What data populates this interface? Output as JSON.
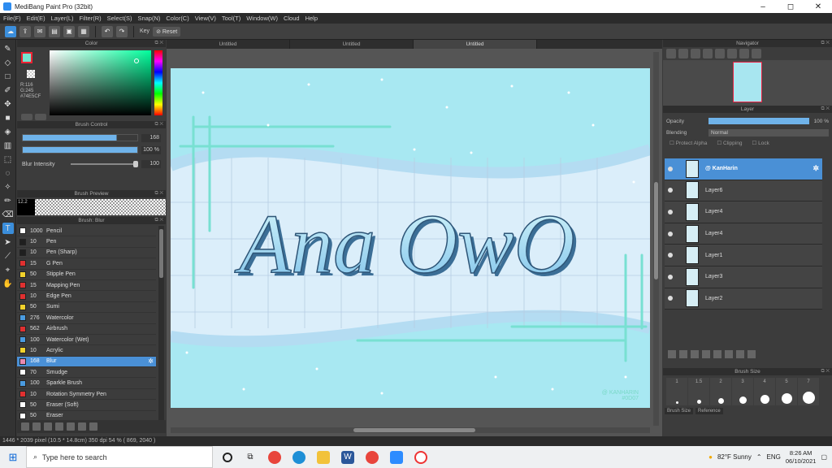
{
  "app": {
    "title": "MediBang Paint Pro (32bit)",
    "window_controls": [
      "–",
      "◻",
      "✕"
    ]
  },
  "menu": [
    "File(F)",
    "Edit(E)",
    "Layer(L)",
    "Filter(R)",
    "Select(S)",
    "Snap(N)",
    "Color(C)",
    "View(V)",
    "Tool(T)",
    "Window(W)",
    "Cloud",
    "Help"
  ],
  "toolbar": {
    "key_label": "Key",
    "reset_label": "Reset"
  },
  "color_panel": {
    "title": "Color",
    "rgb_text": [
      "R:116",
      "G:245",
      "#74E5CF"
    ],
    "accent_hex": "#74E5CF"
  },
  "brush_control": {
    "title": "Brush Control",
    "size_value": "168",
    "opacity_value": "100 %",
    "blur_label": "Blur Intensity",
    "blur_value": "100",
    "size_level": 0.82,
    "opacity_level": 1.0
  },
  "brush_preview": {
    "title": "Brush Preview",
    "size_label": "12.2"
  },
  "brush_list": {
    "title": "Brush: Blur",
    "items": [
      {
        "num": "1000",
        "name": "Pencil",
        "color": "#ffffff"
      },
      {
        "num": "10",
        "name": "Pen",
        "color": "#1f1f1f"
      },
      {
        "num": "10",
        "name": "Pen (Sharp)",
        "color": "#1f1f1f"
      },
      {
        "num": "15",
        "name": "G Pen",
        "color": "#e03030"
      },
      {
        "num": "50",
        "name": "Stipple Pen",
        "color": "#f2d22c"
      },
      {
        "num": "15",
        "name": "Mapping Pen",
        "color": "#e03030"
      },
      {
        "num": "10",
        "name": "Edge Pen",
        "color": "#e03030"
      },
      {
        "num": "50",
        "name": "Sumi",
        "color": "#f2d22c"
      },
      {
        "num": "276",
        "name": "Watercolor",
        "color": "#4a9be0"
      },
      {
        "num": "562",
        "name": "Airbrush",
        "color": "#e03030"
      },
      {
        "num": "100",
        "name": "Watercolor (Wet)",
        "color": "#4a9be0"
      },
      {
        "num": "10",
        "name": "Acrylic",
        "color": "#f2d22c"
      },
      {
        "num": "168",
        "name": "Blur",
        "color": "#ea8ab2",
        "selected": true
      },
      {
        "num": "70",
        "name": "Smudge",
        "color": "#ffffff"
      },
      {
        "num": "100",
        "name": "Sparkle Brush",
        "color": "#4a9be0"
      },
      {
        "num": "10",
        "name": "Rotation Symmetry Pen",
        "color": "#e03030"
      },
      {
        "num": "50",
        "name": "Eraser (Soft)",
        "color": "#ffffff"
      },
      {
        "num": "50",
        "name": "Eraser",
        "color": "#ffffff"
      }
    ]
  },
  "tabs": [
    "Untitled",
    "Untitled",
    "Untitled"
  ],
  "canvas": {
    "title_text": "Ana OwO",
    "signature": [
      "@ KANHARIN",
      "#0D07"
    ]
  },
  "navigator": {
    "title": "Navigator"
  },
  "layer_panel": {
    "title": "Layer",
    "opacity_label": "Opacity",
    "opacity_value": "100 %",
    "blending_label": "Blending",
    "blending_value": "Normal",
    "protect_alpha": "Protect Alpha",
    "clipping": "Clipping",
    "lock": "Lock",
    "layers": [
      {
        "name": "@ KanHarin",
        "selected": true
      },
      {
        "name": "Layer6"
      },
      {
        "name": "Layer4"
      },
      {
        "name": "Layer4"
      },
      {
        "name": "Layer1"
      },
      {
        "name": "Layer3"
      },
      {
        "name": "Layer2"
      }
    ]
  },
  "brush_size": {
    "title": "Brush Size",
    "sizes": [
      "1",
      "1.5",
      "2",
      "3",
      "4",
      "5",
      "7"
    ],
    "tabs": [
      "Brush Size",
      "Reference"
    ]
  },
  "status": {
    "text": "1446 * 2039 pixel  (10.5 * 14.8cm)  350 dpi  54 %  ( 869, 2040 )"
  },
  "taskbar": {
    "search_placeholder": "Type here to search",
    "weather": "82°F Sunny",
    "lang": "ENG",
    "time": "8:26 AM",
    "date": "06/10/2021"
  }
}
